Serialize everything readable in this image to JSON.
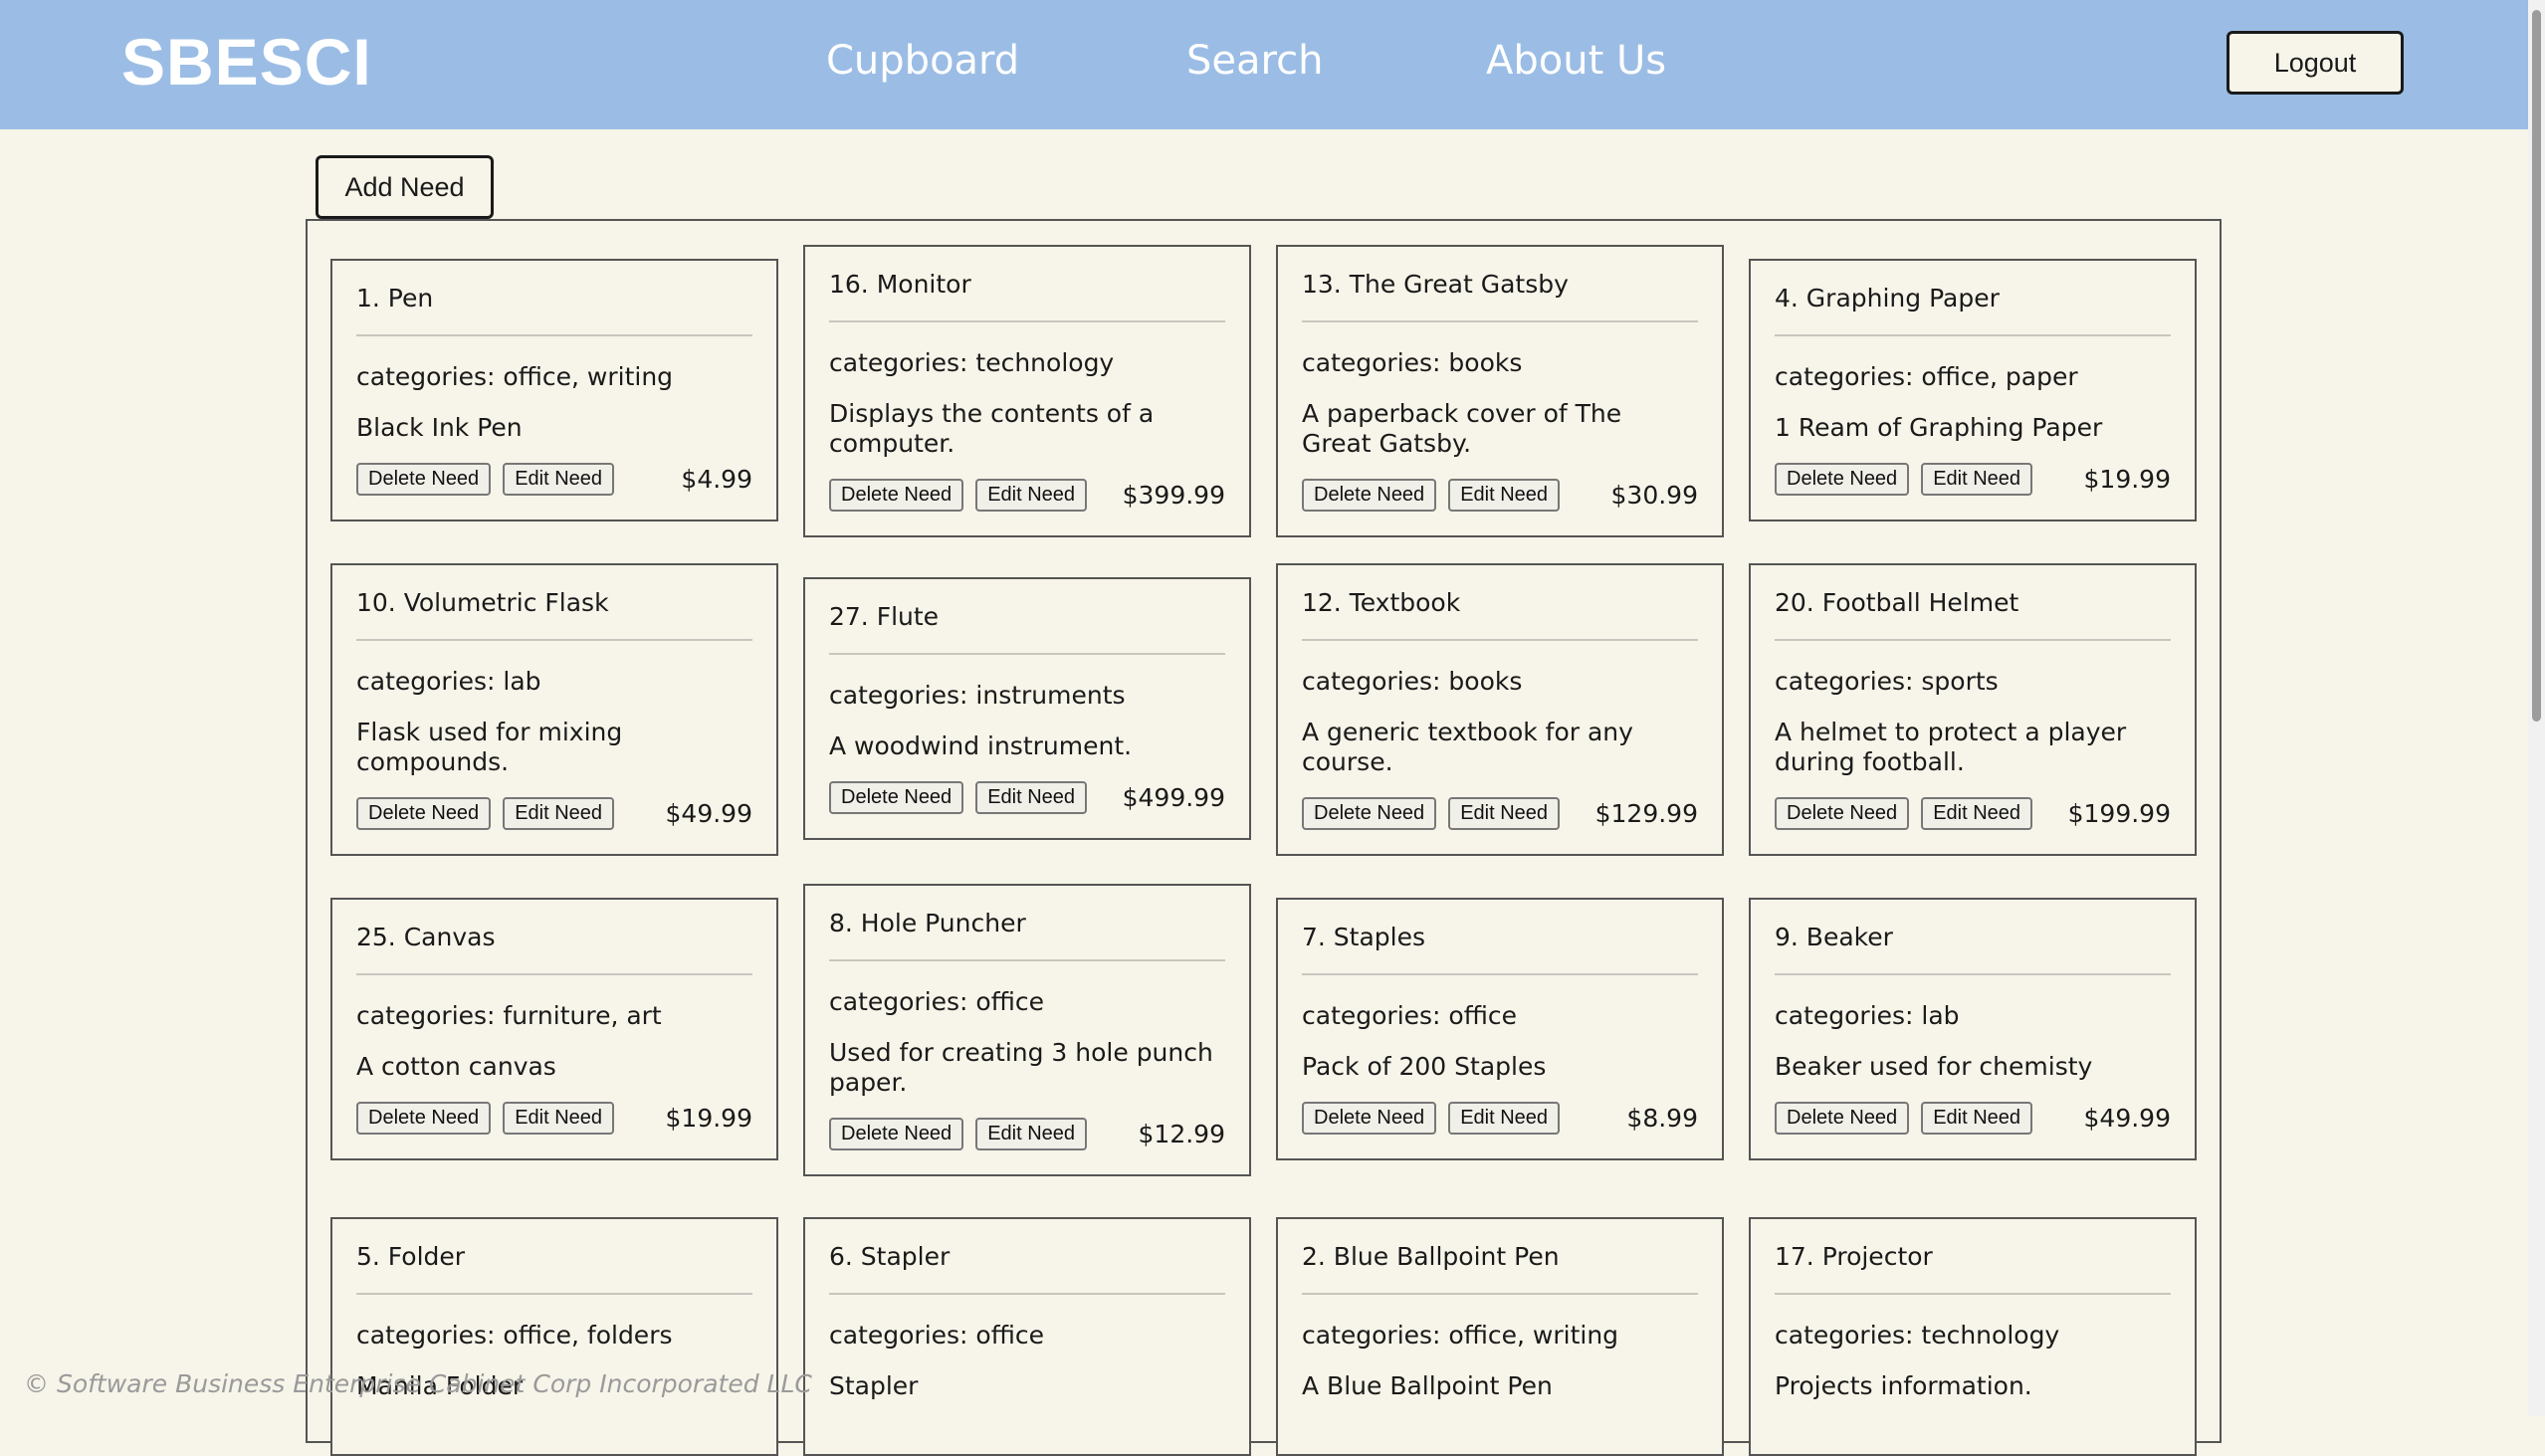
{
  "navbar": {
    "brand": "SBESCI",
    "links": [
      "Cupboard",
      "Search",
      "About Us"
    ],
    "logout_label": "Logout"
  },
  "toolbar": {
    "add_label": "Add Need"
  },
  "labels": {
    "delete": "Delete Need",
    "edit": "Edit Need"
  },
  "needs": [
    {
      "title": "1. Pen",
      "categories": "categories: office, writing",
      "description": "Black Ink Pen",
      "price": "$4.99"
    },
    {
      "title": "16. Monitor",
      "categories": "categories: technology",
      "description": "Displays the contents of a computer.",
      "price": "$399.99"
    },
    {
      "title": "13. The Great Gatsby",
      "categories": "categories: books",
      "description": "A paperback cover of The Great Gatsby.",
      "price": "$30.99"
    },
    {
      "title": "4. Graphing Paper",
      "categories": "categories: office, paper",
      "description": "1 Ream of Graphing Paper",
      "price": "$19.99"
    },
    {
      "title": "10. Volumetric Flask",
      "categories": "categories: lab",
      "description": "Flask used for mixing compounds.",
      "price": "$49.99"
    },
    {
      "title": "27. Flute",
      "categories": "categories: instruments",
      "description": "A woodwind instrument.",
      "price": "$499.99"
    },
    {
      "title": "12. Textbook",
      "categories": "categories: books",
      "description": "A generic textbook for any course.",
      "price": "$129.99"
    },
    {
      "title": "20. Football Helmet",
      "categories": "categories: sports",
      "description": "A helmet to protect a player during football.",
      "price": "$199.99"
    },
    {
      "title": "25. Canvas",
      "categories": "categories: furniture, art",
      "description": "A cotton canvas",
      "price": "$19.99"
    },
    {
      "title": "8. Hole Puncher",
      "categories": "categories: office",
      "description": "Used for creating 3 hole punch paper.",
      "price": "$12.99"
    },
    {
      "title": "7. Staples",
      "categories": "categories: office",
      "description": "Pack of 200 Staples",
      "price": "$8.99"
    },
    {
      "title": "9. Beaker",
      "categories": "categories: lab",
      "description": "Beaker used for chemisty",
      "price": "$49.99"
    },
    {
      "title": "5. Folder",
      "categories": "categories: office, folders",
      "description": "Manila Folder",
      "price": ""
    },
    {
      "title": "6. Stapler",
      "categories": "categories: office",
      "description": "Stapler",
      "price": ""
    },
    {
      "title": "2. Blue Ballpoint Pen",
      "categories": "categories: office, writing",
      "description": "A Blue Ballpoint Pen",
      "price": ""
    },
    {
      "title": "17. Projector",
      "categories": "categories: technology",
      "description": "Projects information.",
      "price": ""
    }
  ],
  "footer": {
    "text": "© Software Business Enterprise Cabinet Corp Incorporated LLC"
  }
}
